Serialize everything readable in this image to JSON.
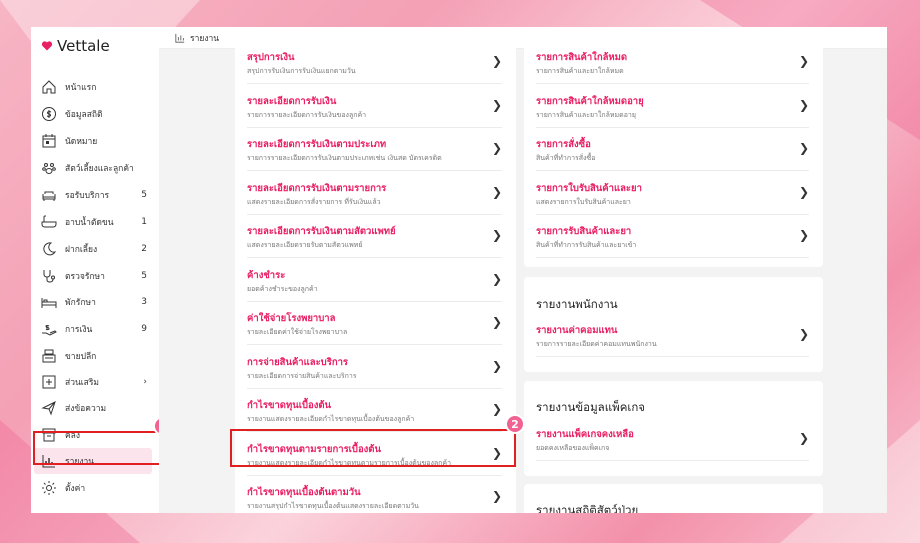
{
  "brand": {
    "name": "Vettale"
  },
  "topbar": {
    "label": "รายงาน"
  },
  "sidebar": {
    "items": [
      {
        "label": "หน้าแรก",
        "icon": "home-icon",
        "count": ""
      },
      {
        "label": "ข้อมูลสถิติ",
        "icon": "dollar-circle-icon",
        "count": ""
      },
      {
        "label": "นัดหมาย",
        "icon": "calendar-icon",
        "count": ""
      },
      {
        "label": "สัตว์เลี้ยงและลูกค้า",
        "icon": "paw-icon",
        "count": ""
      },
      {
        "label": "รอรับบริการ",
        "icon": "sofa-icon",
        "count": "5"
      },
      {
        "label": "อาบน้ำตัดขน",
        "icon": "bathtub-icon",
        "count": "1"
      },
      {
        "label": "ฝากเลี้ยง",
        "icon": "moon-icon",
        "count": "2"
      },
      {
        "label": "ตรวจรักษา",
        "icon": "stethoscope-icon",
        "count": "5"
      },
      {
        "label": "พักรักษา",
        "icon": "bed-icon",
        "count": "3"
      },
      {
        "label": "การเงิน",
        "icon": "hand-money-icon",
        "count": "9"
      },
      {
        "label": "ขายปลีก",
        "icon": "cash-register-icon",
        "count": ""
      },
      {
        "label": "ส่วนเสริม",
        "icon": "plus-square-icon",
        "count": "›"
      },
      {
        "label": "ส่งข้อความ",
        "icon": "send-icon",
        "count": ""
      },
      {
        "label": "คลัง",
        "icon": "archive-icon",
        "count": ""
      },
      {
        "label": "รายงาน",
        "icon": "chart-icon",
        "count": ""
      },
      {
        "label": "ตั้งค่า",
        "icon": "gear-icon",
        "count": ""
      }
    ]
  },
  "left_card": {
    "rows": [
      {
        "title": "สรุปการเงิน",
        "desc": "สรุปการรับเงินการรับเงินแยกตามวัน"
      },
      {
        "title": "รายละเอียดการรับเงิน",
        "desc": "รายการรายละเอียดการรับเงินของลูกค้า"
      },
      {
        "title": "รายละเอียดการรับเงินตามประเภท",
        "desc": "รายการรายละเอียดการรับเงินตามประเภทเช่น เงินสด บัตรเครดิต"
      },
      {
        "title": "รายละเอียดการรับเงินตามรายการ",
        "desc": "แสดงรายละเอียดการสั่งรายการ ที่รับเงินแล้ว"
      },
      {
        "title": "รายละเอียดการรับเงินตามสัตวแพทย์",
        "desc": "แสดงรายละเอียดรายรับตามสัตวแพทย์"
      },
      {
        "title": "ค้างชำระ",
        "desc": "ยอดค้างชำระของลูกค้า"
      },
      {
        "title": "ค่าใช้จ่ายโรงพยาบาล",
        "desc": "รายละเอียดค่าใช้จ่ายโรงพยาบาล"
      },
      {
        "title": "การจ่ายสินค้าและบริการ",
        "desc": "รายละเอียดการจ่ายสินค้าและบริการ"
      },
      {
        "title": "กำไรขาดทุนเบื้องต้น",
        "desc": "รายงานแสดงรายละเอียดกำไรขาดทุนเบื้องต้นของลูกค้า"
      },
      {
        "title": "กำไรขาดทุนตามรายการเบื้องต้น",
        "desc": "รายงานแสดงรายละเอียดกำไรขาดทุนตามรายการเบื้องต้นของลูกค้า"
      },
      {
        "title": "กำไรขาดทุนเบื้องต้นตามวัน",
        "desc": "รายงานสรุปกำไรขาดทุนเบื้องต้นแสดงรายละเอียดตามวัน"
      }
    ]
  },
  "right_card_top": {
    "rows": [
      {
        "title": "รายการสินค้าใกล้หมด",
        "desc": "รายการสินค้าและยาใกล้หมด"
      },
      {
        "title": "รายการสินค้าใกล้หมดอายุ",
        "desc": "รายการสินค้าและยาใกล้หมดอายุ"
      },
      {
        "title": "รายการสั่งซื้อ",
        "desc": "สินค้าที่ทำการสั่งซื้อ"
      },
      {
        "title": "รายการใบรับสินค้าและยา",
        "desc": "แสดงรายการใบรับสินค้าและยา"
      },
      {
        "title": "รายการรับสินค้าและยา",
        "desc": "สินค้าที่ทำการรับสินค้าและยาเข้า"
      }
    ]
  },
  "staff_section": {
    "title": "รายงานพนักงาน",
    "rows": [
      {
        "title": "รายงานค่าคอมแทน",
        "desc": "รายการรายละเอียดค่าคอมแทนพนักงาน"
      }
    ]
  },
  "package_section": {
    "title": "รายงานข้อมูลแพ็คเกจ",
    "rows": [
      {
        "title": "รายงานแพ็คเกจคงเหลือ",
        "desc": "ยอดคงเหลือของแพ็คเกจ"
      }
    ]
  },
  "sick_section": {
    "title": "รายงานสถิติสัตว์ป่วย"
  },
  "annotations": {
    "badge1": "1",
    "badge2": "2"
  },
  "colors": {
    "accent": "#e91e63",
    "highlight": "#e02020",
    "badge": "#f06292"
  }
}
